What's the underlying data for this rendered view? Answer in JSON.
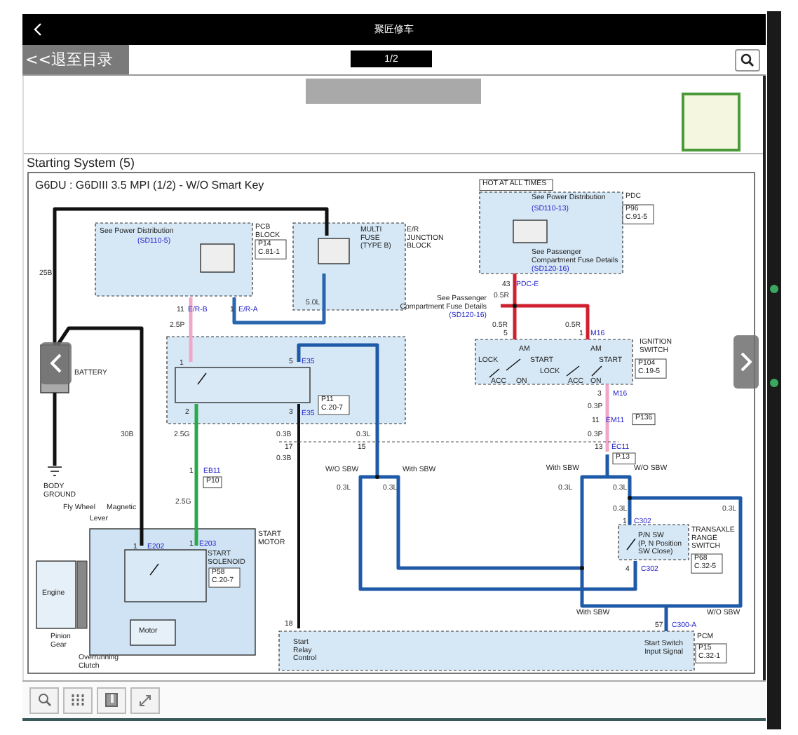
{
  "app_bar": {
    "title": "聚匠修车"
  },
  "toolbar": {
    "back_button": "<<退至目录",
    "page_indicator": "1/2"
  },
  "heading": "Starting System (5)",
  "diagram": {
    "title": "G6DU : G6DIII 3.5 MPI (1/2) - W/O Smart Key",
    "labels": [
      {
        "kind": "ref-text",
        "text": "See Power Distribution"
      },
      {
        "kind": "ref",
        "text": "(SD110-5)"
      },
      {
        "kind": "part",
        "text": "PCB\nBLOCK"
      },
      {
        "kind": "box",
        "text": "P14\nC.81-1"
      },
      {
        "kind": "part",
        "text": "MULTI\nFUSE\n(TYPE B)"
      },
      {
        "kind": "part",
        "text": "E/R\nJUNCTION\nBLOCK"
      },
      {
        "kind": "wire",
        "text": "25B"
      },
      {
        "kind": "wire",
        "text": "5.0L"
      },
      {
        "kind": "pin",
        "text": "11"
      },
      {
        "kind": "conn",
        "text": "E/R-B"
      },
      {
        "kind": "pin",
        "text": "1"
      },
      {
        "kind": "conn",
        "text": "E/R-A"
      },
      {
        "kind": "wire",
        "text": "2.5P"
      },
      {
        "kind": "part",
        "text": "BATTERY"
      },
      {
        "kind": "pin",
        "text": "1"
      },
      {
        "kind": "pin",
        "text": "5"
      },
      {
        "kind": "conn",
        "text": "E35"
      },
      {
        "kind": "pin",
        "text": "2"
      },
      {
        "kind": "pin",
        "text": "3"
      },
      {
        "kind": "conn",
        "text": "E35"
      },
      {
        "kind": "box",
        "text": "P11\nC.20-7"
      },
      {
        "kind": "wire",
        "text": "30B"
      },
      {
        "kind": "wire",
        "text": "2.5G"
      },
      {
        "kind": "wire",
        "text": "0.3B"
      },
      {
        "kind": "wire",
        "text": "0.3L"
      },
      {
        "kind": "pin",
        "text": "17"
      },
      {
        "kind": "pin",
        "text": "15"
      },
      {
        "kind": "wire",
        "text": "0.3B"
      },
      {
        "kind": "part",
        "text": "BODY\nGROUND"
      },
      {
        "kind": "pin",
        "text": "1"
      },
      {
        "kind": "conn",
        "text": "EB11"
      },
      {
        "kind": "box",
        "text": "P10"
      },
      {
        "kind": "wire",
        "text": "2.5G"
      },
      {
        "kind": "part",
        "text": "Fly Wheel"
      },
      {
        "kind": "part",
        "text": "Magnetic"
      },
      {
        "kind": "part",
        "text": "Lever"
      },
      {
        "kind": "part",
        "text": "START\nMOTOR"
      },
      {
        "kind": "pin",
        "text": "1"
      },
      {
        "kind": "conn",
        "text": "E202"
      },
      {
        "kind": "pin",
        "text": "1"
      },
      {
        "kind": "conn",
        "text": "E203"
      },
      {
        "kind": "part",
        "text": "START\nSOLENOID"
      },
      {
        "kind": "box",
        "text": "P58\nC.20-7"
      },
      {
        "kind": "part",
        "text": "Engine"
      },
      {
        "kind": "part",
        "text": "Pinion\nGear"
      },
      {
        "kind": "part",
        "text": "Motor"
      },
      {
        "kind": "part",
        "text": "Overrunning\nClutch"
      },
      {
        "kind": "pin",
        "text": "18"
      },
      {
        "kind": "part",
        "text": "Start\nRelay\nControl"
      },
      {
        "kind": "sbw",
        "text": "W/O SBW"
      },
      {
        "kind": "sbw",
        "text": "With SBW"
      },
      {
        "kind": "wire",
        "text": "0.3L"
      },
      {
        "kind": "wire",
        "text": "0.3L"
      },
      {
        "kind": "hot",
        "text": "HOT AT ALL TIMES"
      },
      {
        "kind": "part",
        "text": "PDC"
      },
      {
        "kind": "box",
        "text": "P96\nC.91-5"
      },
      {
        "kind": "ref-text",
        "text": "See Power Distribution"
      },
      {
        "kind": "ref",
        "text": "(SD110-13)"
      },
      {
        "kind": "ref-text",
        "text": "See Passenger\nCompartment Fuse Details"
      },
      {
        "kind": "ref",
        "text": "(SD120-16)"
      },
      {
        "kind": "pin",
        "text": "43"
      },
      {
        "kind": "conn",
        "text": "PDC-E"
      },
      {
        "kind": "wire",
        "text": "0.5R"
      },
      {
        "kind": "ref-text",
        "text": "See Passenger\nCompartment Fuse Details"
      },
      {
        "kind": "ref",
        "text": "(SD120-16)"
      },
      {
        "kind": "wire",
        "text": "0.5R"
      },
      {
        "kind": "pin",
        "text": "5"
      },
      {
        "kind": "wire",
        "text": "0.5R"
      },
      {
        "kind": "pin",
        "text": "1"
      },
      {
        "kind": "conn",
        "text": "M16"
      },
      {
        "kind": "part",
        "text": "AM"
      },
      {
        "kind": "part",
        "text": "AM"
      },
      {
        "kind": "part",
        "text": "IGNITION\nSWITCH"
      },
      {
        "kind": "box",
        "text": "P104\nC.19-5"
      },
      {
        "kind": "part",
        "text": "LOCK"
      },
      {
        "kind": "part",
        "text": "START"
      },
      {
        "kind": "part",
        "text": "START"
      },
      {
        "kind": "part",
        "text": "LOCK"
      },
      {
        "kind": "part",
        "text": "ACC"
      },
      {
        "kind": "part",
        "text": "ON"
      },
      {
        "kind": "part",
        "text": "ACC"
      },
      {
        "kind": "part",
        "text": "ON"
      },
      {
        "kind": "pin",
        "text": "3"
      },
      {
        "kind": "conn",
        "text": "M16"
      },
      {
        "kind": "wire",
        "text": "0.3P"
      },
      {
        "kind": "pin",
        "text": "11"
      },
      {
        "kind": "conn",
        "text": "EM11"
      },
      {
        "kind": "box",
        "text": "P136"
      },
      {
        "kind": "wire",
        "text": "0.3P"
      },
      {
        "kind": "pin",
        "text": "13"
      },
      {
        "kind": "conn",
        "text": "EC11"
      },
      {
        "kind": "box",
        "text": "P.13"
      },
      {
        "kind": "sbw",
        "text": "With SBW"
      },
      {
        "kind": "sbw",
        "text": "W/O SBW"
      },
      {
        "kind": "wire",
        "text": "0.3L"
      },
      {
        "kind": "wire",
        "text": "0.3L"
      },
      {
        "kind": "wire",
        "text": "0.3L"
      },
      {
        "kind": "wire",
        "text": "0.3L"
      },
      {
        "kind": "pin",
        "text": "1"
      },
      {
        "kind": "conn",
        "text": "C302"
      },
      {
        "kind": "part",
        "text": "P/N SW\n(P, N Position\nSW Close)"
      },
      {
        "kind": "part",
        "text": "TRANSAXLE\nRANGE\nSWITCH"
      },
      {
        "kind": "box",
        "text": "P68\nC.32-5"
      },
      {
        "kind": "pin",
        "text": "4"
      },
      {
        "kind": "conn",
        "text": "C302"
      },
      {
        "kind": "sbw",
        "text": "With SBW"
      },
      {
        "kind": "sbw",
        "text": "W/O SBW"
      },
      {
        "kind": "pin",
        "text": "57"
      },
      {
        "kind": "conn",
        "text": "C300-A"
      },
      {
        "kind": "part",
        "text": "Start Switch\nInput Signal"
      },
      {
        "kind": "part",
        "text": "PCM"
      },
      {
        "kind": "box",
        "text": "P15\nC.32-1"
      }
    ]
  }
}
